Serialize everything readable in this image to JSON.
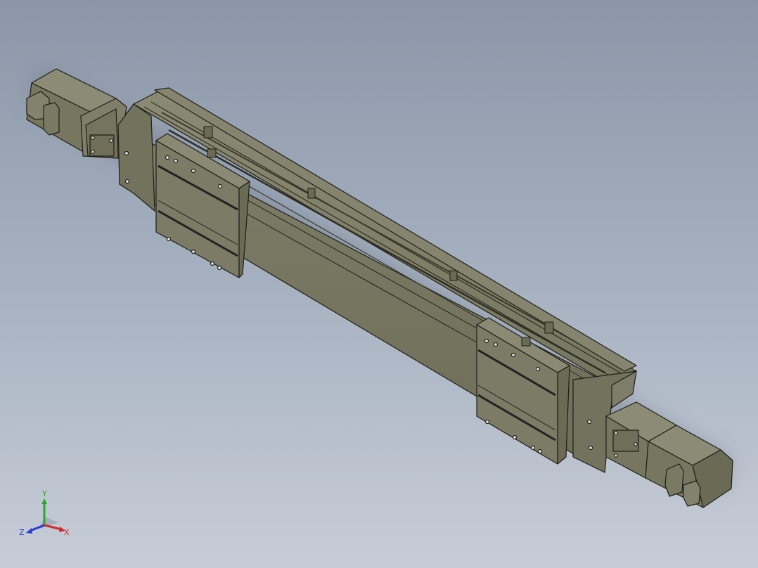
{
  "viewport": {
    "background_top": "#8b97a8",
    "background_bottom": "#c7cdd7",
    "model_color": "#7b7b67",
    "edge_color": "#1e1e18"
  },
  "triad": {
    "x_label": "X",
    "y_label": "Y",
    "z_label": "Z",
    "x_color": "#d12a2a",
    "y_color": "#2aa82a",
    "z_color": "#2a3ad1"
  }
}
